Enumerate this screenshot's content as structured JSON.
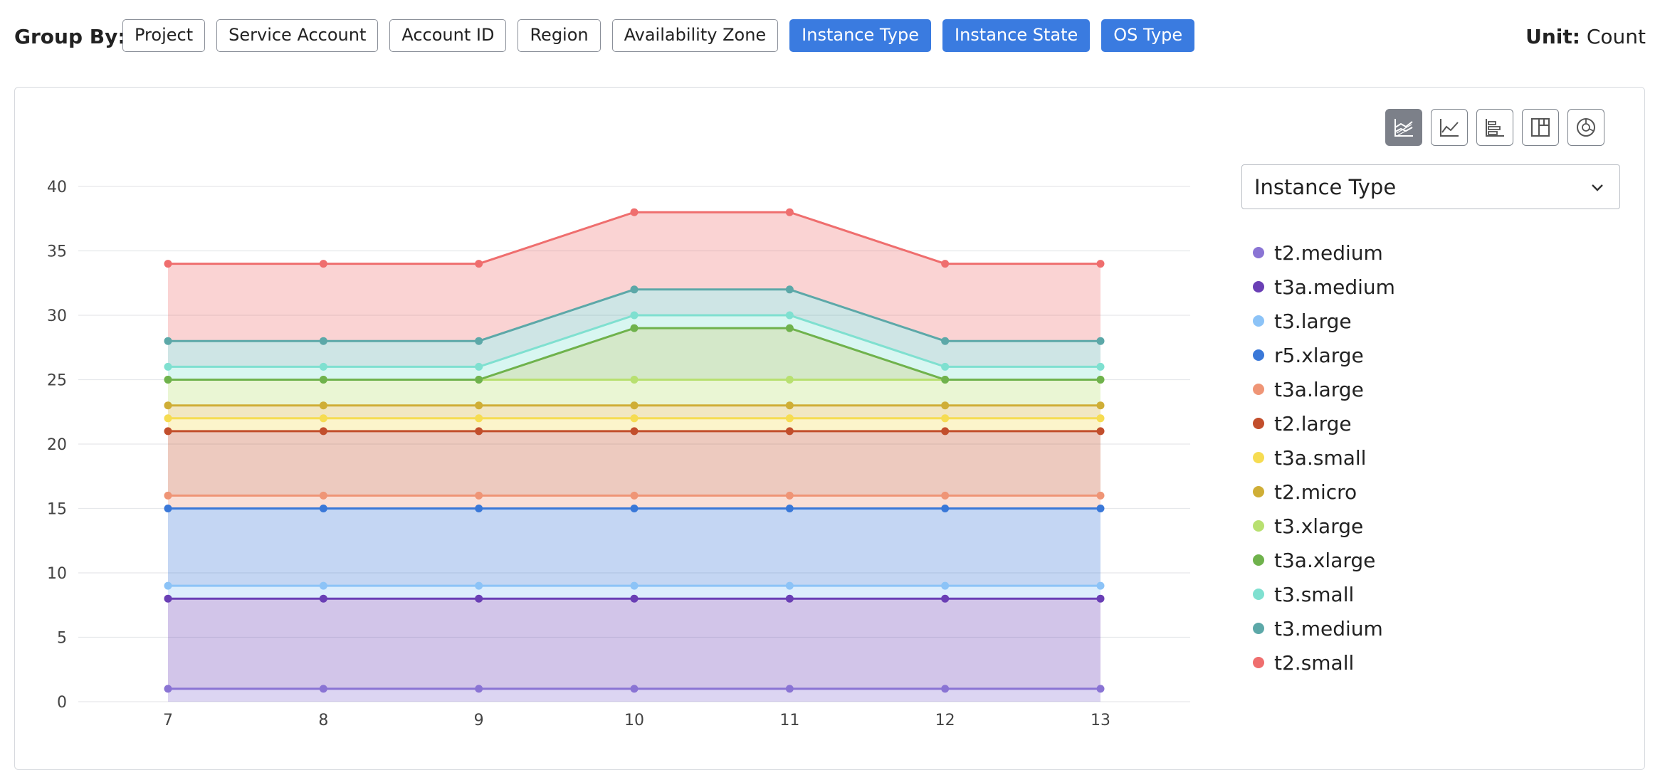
{
  "toolbar": {
    "group_by_label": "Group By:",
    "chips": [
      {
        "label": "Project",
        "active": false
      },
      {
        "label": "Service Account",
        "active": false
      },
      {
        "label": "Account ID",
        "active": false
      },
      {
        "label": "Region",
        "active": false
      },
      {
        "label": "Availability Zone",
        "active": false
      },
      {
        "label": "Instance Type",
        "active": true
      },
      {
        "label": "Instance State",
        "active": true
      },
      {
        "label": "OS Type",
        "active": true
      }
    ],
    "unit_label": "Unit:",
    "unit_value": "Count"
  },
  "chart_types": [
    {
      "icon": "stacked-area-chart-icon",
      "active": true
    },
    {
      "icon": "line-chart-icon",
      "active": false
    },
    {
      "icon": "bar-chart-icon",
      "active": false
    },
    {
      "icon": "treemap-icon",
      "active": false
    },
    {
      "icon": "pie-chart-icon",
      "active": false
    }
  ],
  "dimension_select": {
    "value": "Instance Type"
  },
  "chart_data": {
    "type": "area",
    "stacked": true,
    "x": [
      7,
      8,
      9,
      10,
      11,
      12,
      13
    ],
    "ylim": [
      0,
      40
    ],
    "yticks": [
      0,
      5,
      10,
      15,
      20,
      25,
      30,
      35,
      40
    ],
    "grid": true,
    "legend_position": "right",
    "series": [
      {
        "name": "t2.medium",
        "color": "#8a74d4",
        "values": [
          1,
          1,
          1,
          1,
          1,
          1,
          1
        ]
      },
      {
        "name": "t3a.medium",
        "color": "#6a3fb5",
        "values": [
          7,
          7,
          7,
          7,
          7,
          7,
          7
        ]
      },
      {
        "name": "t3.large",
        "color": "#8cc3f7",
        "values": [
          1,
          1,
          1,
          1,
          1,
          1,
          1
        ]
      },
      {
        "name": "r5.xlarge",
        "color": "#3a78d8",
        "values": [
          6,
          6,
          6,
          6,
          6,
          6,
          6
        ]
      },
      {
        "name": "t3a.large",
        "color": "#ef9576",
        "values": [
          1,
          1,
          1,
          1,
          1,
          1,
          1
        ]
      },
      {
        "name": "t2.large",
        "color": "#c24e2c",
        "values": [
          5,
          5,
          5,
          5,
          5,
          5,
          5
        ]
      },
      {
        "name": "t3a.small",
        "color": "#f6dc52",
        "values": [
          1,
          1,
          1,
          1,
          1,
          1,
          1
        ]
      },
      {
        "name": "t2.micro",
        "color": "#cfae36",
        "values": [
          1,
          1,
          1,
          1,
          1,
          1,
          1
        ]
      },
      {
        "name": "t3.xlarge",
        "color": "#b8e070",
        "values": [
          2,
          2,
          2,
          2,
          2,
          2,
          2
        ]
      },
      {
        "name": "t3a.xlarge",
        "color": "#6fb24c",
        "values": [
          0,
          0,
          0,
          4,
          4,
          0,
          0
        ]
      },
      {
        "name": "t3.small",
        "color": "#7fe0d0",
        "values": [
          1,
          1,
          1,
          1,
          1,
          1,
          1
        ]
      },
      {
        "name": "t3.medium",
        "color": "#5ca8a8",
        "values": [
          2,
          2,
          2,
          2,
          2,
          2,
          2
        ]
      },
      {
        "name": "t2.small",
        "color": "#ef6e6e",
        "values": [
          6,
          6,
          6,
          6,
          6,
          6,
          6
        ]
      }
    ]
  }
}
